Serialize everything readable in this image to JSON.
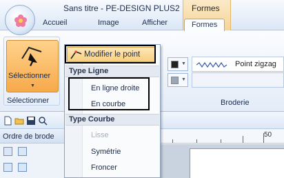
{
  "window": {
    "title": "Sans titre - PE-DESIGN PLUS2",
    "context_group": "Formes"
  },
  "tabs": [
    {
      "label": "Accueil",
      "active": false
    },
    {
      "label": "Image",
      "active": false
    },
    {
      "label": "Afficher",
      "active": false
    },
    {
      "label": "Formes",
      "active": true
    }
  ],
  "ribbon": {
    "select_button_label": "Sélectionner",
    "select_group_label": "Sélectionner",
    "stitch_type": "Point zigzag",
    "broderie_group_label": "Broderie",
    "line_color": "#222222",
    "fill_color": "#9aa7b8"
  },
  "pane": {
    "title": "Ordre de brode"
  },
  "ruler": {
    "mark": "50"
  },
  "menu": {
    "modify_label": "Modifier le point",
    "line_type_header": "Type Ligne",
    "line_options": [
      {
        "label": "En ligne droite",
        "enabled": true
      },
      {
        "label": "En courbe",
        "enabled": true
      }
    ],
    "curve_type_header": "Type Courbe",
    "curve_options": [
      {
        "label": "Lisse",
        "enabled": false
      },
      {
        "label": "Symétrie",
        "enabled": true
      },
      {
        "label": "Froncer",
        "enabled": true
      }
    ]
  },
  "colors": {
    "accent_orange": "#f7a94a",
    "ribbon_blue": "#dbe7f6",
    "highlight_border": "#000000"
  }
}
